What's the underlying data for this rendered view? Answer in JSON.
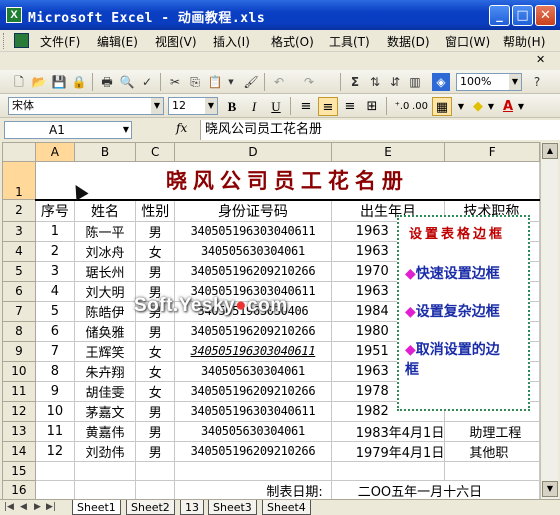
{
  "window": {
    "title": "Microsoft Excel - 动画教程.xls",
    "app_icon_text": "X"
  },
  "menus": [
    "文件(F)",
    "编辑(E)",
    "视图(V)",
    "插入(I)",
    "格式(O)",
    "工具(T)",
    "数据(D)",
    "窗口(W)",
    "帮助(H)"
  ],
  "toolbar": {
    "zoom": "100%",
    "font": "宋体",
    "font_size": "12"
  },
  "namebox": "A1",
  "fx_label": "fx",
  "formula": "晓风公司员工花名册",
  "columns": [
    "A",
    "B",
    "C",
    "D",
    "E",
    "F"
  ],
  "row_numbers": [
    "1",
    "2",
    "3",
    "4",
    "5",
    "6",
    "7",
    "8",
    "9",
    "10",
    "11",
    "12",
    "13",
    "14",
    "15",
    "16",
    "17"
  ],
  "sheet_title": "晓风公司员工花名册",
  "headers": [
    "序号",
    "姓名",
    "性别",
    "身份证号码",
    "出生年月",
    "技术职称"
  ],
  "rows": [
    {
      "no": "1",
      "name": "陈一平",
      "sex": "男",
      "id": "340505196303040611",
      "birth": "1963",
      "title": ""
    },
    {
      "no": "2",
      "name": "刘冰舟",
      "sex": "女",
      "id": "340505630304061",
      "birth": "1963",
      "title": ""
    },
    {
      "no": "3",
      "name": "琚长州",
      "sex": "男",
      "id": "340505196209210266",
      "birth": "1970",
      "title": ""
    },
    {
      "no": "4",
      "name": "刘大明",
      "sex": "男",
      "id": "340505196303040611",
      "birth": "1963",
      "title": ""
    },
    {
      "no": "5",
      "name": "陈皓伊",
      "sex": "男",
      "id": "3405051963030406",
      "birth": "1984",
      "title": ""
    },
    {
      "no": "6",
      "name": "储奂雅",
      "sex": "男",
      "id": "340505196209210266",
      "birth": "1980",
      "title": ""
    },
    {
      "no": "7",
      "name": "王辉笑",
      "sex": "女",
      "id": "340505196303040611",
      "birth": "1951",
      "title": ""
    },
    {
      "no": "8",
      "name": "朱卉翔",
      "sex": "女",
      "id": "340505630304061",
      "birth": "1963",
      "title": ""
    },
    {
      "no": "9",
      "name": "胡佳雯",
      "sex": "女",
      "id": "340505196209210266",
      "birth": "1978",
      "title": ""
    },
    {
      "no": "10",
      "name": "茅嘉文",
      "sex": "男",
      "id": "340505196303040611",
      "birth": "1982",
      "title": ""
    },
    {
      "no": "11",
      "name": "黄嘉伟",
      "sex": "男",
      "id": "340505630304061",
      "birth": "1983年4月1日",
      "title": "助理工程"
    },
    {
      "no": "12",
      "name": "刘劲伟",
      "sex": "男",
      "id": "340505196209210266",
      "birth": "1979年4月1日",
      "title": "其他职"
    }
  ],
  "footer": {
    "label": "制表日期:",
    "date": "二OO五年一月十六日"
  },
  "popup": {
    "title": "设置表格边框",
    "bullet": "◆",
    "items": [
      "快速设置边框",
      "设置复杂边框",
      "取消设置的边",
      "框"
    ]
  },
  "watermark": {
    "pre": "Soft.Yesky",
    "dot": "●",
    "post": "com"
  },
  "tabs": [
    "Sheet1",
    "Sheet2",
    "13",
    "Sheet3",
    "Sheet4"
  ]
}
